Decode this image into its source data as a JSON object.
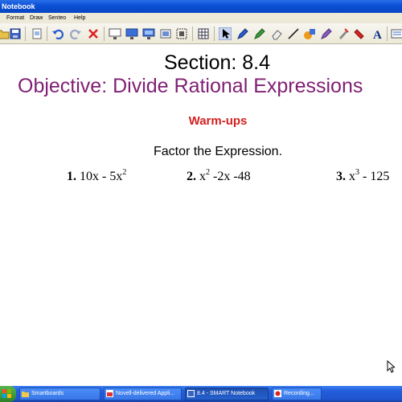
{
  "window": {
    "title": "Notebook"
  },
  "menu": {
    "items": [
      "Format",
      "Draw",
      "Senteo",
      "Help"
    ]
  },
  "toolbar": {
    "icons": [
      "open-icon",
      "save-icon",
      "page-icon",
      "undo-icon",
      "redo-icon",
      "delete-icon",
      "screen-shade-icon",
      "display-icon",
      "full-screen-icon",
      "capture-icon",
      "screen-capture-icon",
      "table-icon",
      "select-icon",
      "pen-icon",
      "creative-pen-icon",
      "eraser-icon",
      "line-icon",
      "shapes-icon",
      "magic-pen-icon",
      "fill-icon",
      "text-icon",
      "properties-icon"
    ]
  },
  "slide": {
    "section_title": "Section: 8.4",
    "objective": "Objective: Divide Rational Expressions",
    "warmups": "Warm-ups",
    "instruction": "Factor the Expression.",
    "problems": [
      {
        "number": "1.",
        "expr": "10x - 5x",
        "sup": "2",
        "tail": ""
      },
      {
        "number": "2.",
        "expr": "x",
        "sup": "2",
        "tail": " -2x -48"
      },
      {
        "number": "3.",
        "expr": "x",
        "sup": "3",
        "tail": " - 125"
      }
    ],
    "colors": {
      "objective": "#7f1f73",
      "warmups": "#d42020"
    }
  },
  "taskbar": {
    "tasks": [
      {
        "label": "Smartboards",
        "active": false
      },
      {
        "label": "Novell-delivered Appli...",
        "active": false
      },
      {
        "label": "8.4 - SMART Notebook",
        "active": true
      },
      {
        "label": "Recording...",
        "active": false
      }
    ]
  }
}
